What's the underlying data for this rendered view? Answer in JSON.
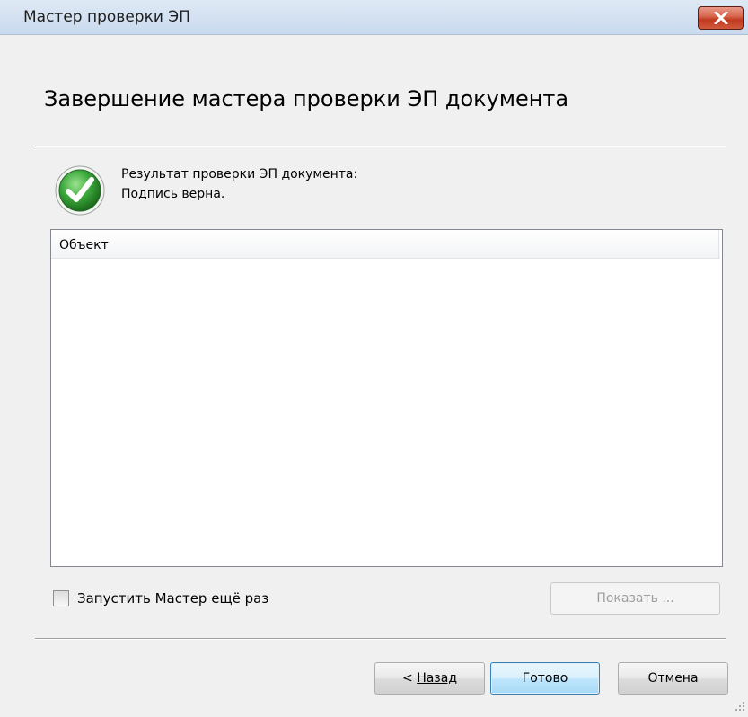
{
  "window": {
    "title": "Мастер проверки ЭП",
    "close_icon": "close-icon"
  },
  "page": {
    "title": "Завершение мастера проверки ЭП документа"
  },
  "result": {
    "icon": "checkmark-success-icon",
    "line1": "Результат проверки ЭП документа:",
    "line2": "Подпись верна."
  },
  "list": {
    "columns": [
      "Объект"
    ],
    "rows": []
  },
  "options": {
    "restart_label": "Запустить Мастер ещё раз",
    "restart_checked": false,
    "show_label": "Показать ..."
  },
  "footer": {
    "back_prefix": "< ",
    "back_label": "Назад",
    "finish_label": "Готово",
    "cancel_label": "Отмена"
  },
  "colors": {
    "close_button": "#c7442a",
    "default_button_border": "#3c7fb1",
    "success_green": "#3aa63a"
  }
}
